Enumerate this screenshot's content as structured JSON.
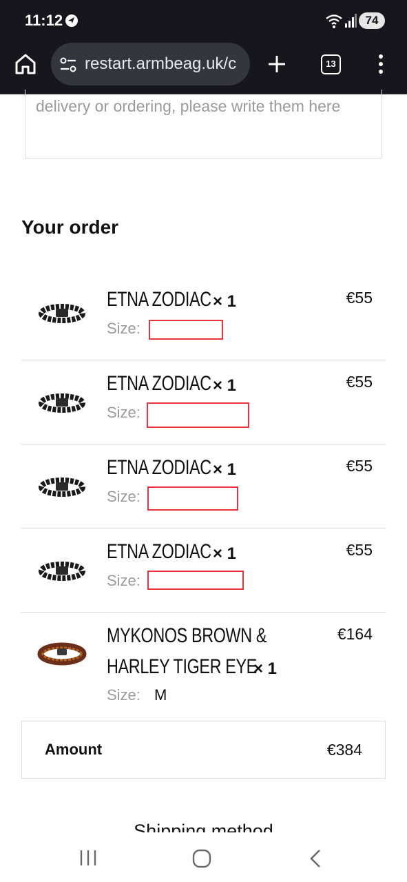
{
  "status_bar": {
    "time": "11:12",
    "battery": "74"
  },
  "browser": {
    "url": "restart.armbeag.uk/c",
    "tab_count": "13"
  },
  "notes": {
    "text": "delivery or ordering, please write them here"
  },
  "order": {
    "title": "Your order",
    "size_label": "Size:",
    "items": [
      {
        "name": "ETNA ZODIAC",
        "qty": "× 1",
        "price": "€55",
        "size": ""
      },
      {
        "name": "ETNA ZODIAC",
        "qty": "× 1",
        "price": "€55",
        "size": ""
      },
      {
        "name": "ETNA ZODIAC",
        "qty": "× 1",
        "price": "€55",
        "size": ""
      },
      {
        "name": "ETNA ZODIAC",
        "qty": "× 1",
        "price": "€55",
        "size": ""
      },
      {
        "name_line1": "MYKONOS BROWN &",
        "name_line2": "HARLEY TIGER EYE",
        "qty": "× 1",
        "price": "€164",
        "size": "M"
      }
    ],
    "amount_label": "Amount",
    "amount_value": "€384"
  },
  "shipping": {
    "heading": "Shipping method"
  },
  "colors": {
    "redaction": "#e8323c",
    "status_bg": "#16161c"
  }
}
